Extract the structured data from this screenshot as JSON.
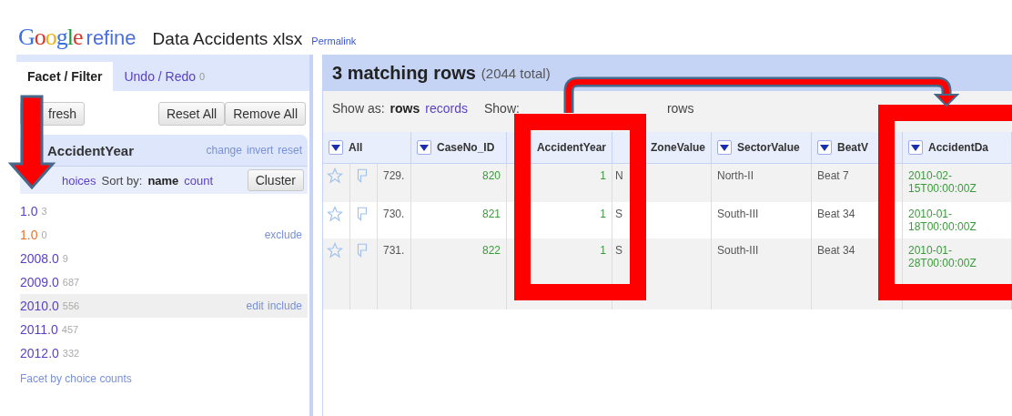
{
  "header": {
    "logo": "Google",
    "product": "refine",
    "project_title": "Data Accidents xlsx",
    "permalink": "Permalink"
  },
  "left_panel": {
    "tabs": [
      {
        "label": "Facet / Filter",
        "selected": true
      },
      {
        "label": "Undo / Redo",
        "count": "0",
        "selected": false
      }
    ],
    "refresh_button": "fresh",
    "reset_all_button": "Reset All",
    "remove_all_button": "Remove All",
    "facet": {
      "title": "AccidentYear",
      "actions": [
        "change",
        "invert",
        "reset"
      ],
      "choices_link": "hoices",
      "sort_label": "Sort by:",
      "sort_options": [
        {
          "label": "name",
          "selected": true
        },
        {
          "label": "count",
          "selected": false
        }
      ],
      "cluster_button": "Cluster",
      "choices": [
        {
          "label": "1.0",
          "count": "3",
          "selected": false,
          "highlighted": false
        },
        {
          "label": "1.0",
          "count": "0",
          "selected": true,
          "highlighted": false,
          "actions": [
            "exclude"
          ]
        },
        {
          "label": "2008.0",
          "count": "9",
          "selected": false,
          "highlighted": false
        },
        {
          "label": "2009.0",
          "count": "687",
          "selected": false,
          "highlighted": false
        },
        {
          "label": "2010.0",
          "count": "556",
          "selected": false,
          "highlighted": true,
          "actions": [
            "edit",
            "include"
          ]
        },
        {
          "label": "2011.0",
          "count": "457",
          "selected": false,
          "highlighted": false
        },
        {
          "label": "2012.0",
          "count": "332",
          "selected": false,
          "highlighted": false
        }
      ],
      "footer_link": "Facet by choice counts"
    }
  },
  "main": {
    "title": "3 matching rows",
    "total": "(2044 total)",
    "show_as_label": "Show as:",
    "show_as_options": [
      {
        "label": "rows",
        "selected": true
      },
      {
        "label": "records",
        "selected": false
      }
    ],
    "show_label": "Show:",
    "rows_label": "rows",
    "table": {
      "columns": [
        {
          "label": "All",
          "menu": true
        },
        {
          "label": "CaseNo_ID",
          "menu": true
        },
        {
          "label": "AccidentYear",
          "menu": false
        },
        {
          "label": "ZoneValue",
          "menu": false
        },
        {
          "label": "SectorValue",
          "menu": true
        },
        {
          "label": "BeatV",
          "menu": true
        },
        {
          "label": "AccidentDa",
          "menu": true
        }
      ],
      "rows": [
        {
          "starred": false,
          "flagged": false,
          "cells": [
            "729.",
            "820",
            "1",
            "N",
            "North-II",
            "Beat 7",
            "2010-02-15T00:00:00Z"
          ]
        },
        {
          "starred": false,
          "flagged": false,
          "cells": [
            "730.",
            "821",
            "1",
            "S",
            "South-III",
            "Beat 34",
            "2010-01-18T00:00:00Z"
          ]
        },
        {
          "starred": false,
          "flagged": false,
          "cells": [
            "731.",
            "822",
            "1",
            "S",
            "South-III",
            "Beat 34",
            "2010-01-28T00:00:00Z"
          ]
        }
      ]
    }
  }
}
